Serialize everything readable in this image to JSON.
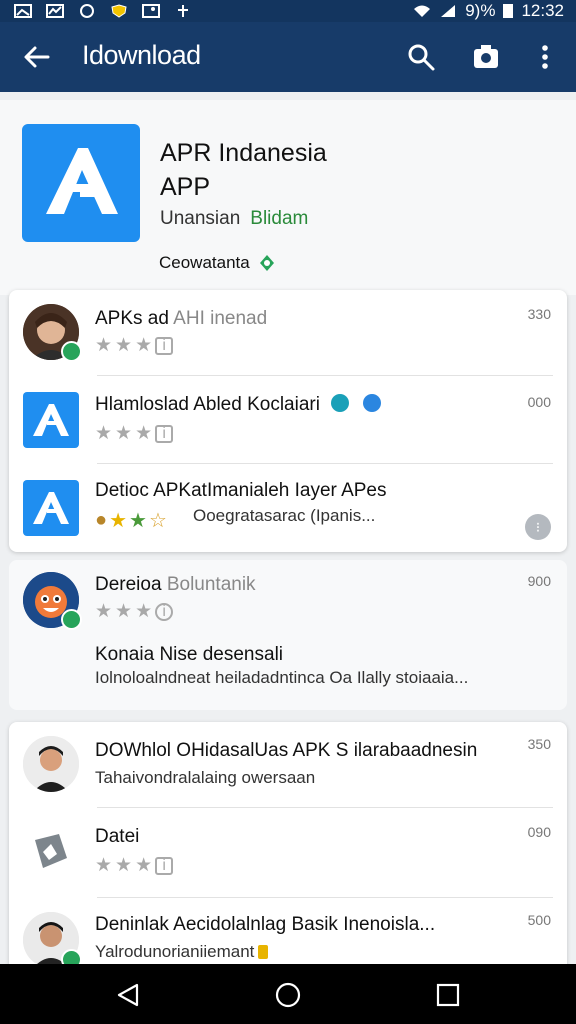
{
  "status_bar": {
    "battery": "9)%",
    "time": "12:32"
  },
  "app_bar": {
    "title": "Idownload"
  },
  "app_header": {
    "title_line1": "APR Indanesia",
    "title_line2": "APP",
    "developer": "Unansian",
    "developer_tag": "Blidam",
    "status": "Ceowatanta"
  },
  "list_card1": [
    {
      "title": "APKs ad ",
      "title_grey": "AHI inenad",
      "size": "330"
    },
    {
      "title": "Hlamloslad Abled Koclaiari",
      "size": "000"
    },
    {
      "title": "Detioc APKatImanialeh Iayer APes",
      "subtitle": "Ooegratasarac (Ipanis..."
    }
  ],
  "list_card2": {
    "title": "Dereioa ",
    "title_grey": "Boluntanik",
    "size": "900",
    "line1": "Konaia Nise desensali",
    "line2": "Iolnoloalndneat heiladadntinca Oa Ilally stoiaaia..."
  },
  "list_card3": [
    {
      "title": "DOWhlol OHidasalUas APK S ilarabaadnesin",
      "subtitle": "Tahaivondralalaing owersaan",
      "size": "350"
    },
    {
      "title": "Datei",
      "size": "090"
    },
    {
      "title": "Deninlak Aecidolalnlag Basik Inenoisla...",
      "subtitle": "Yalrodunorianiiemant",
      "size": "500"
    }
  ],
  "colors": {
    "appbar": "#173b69",
    "statusbar": "#13355f",
    "accent_blue": "#1f8ef0",
    "green": "#27a45a"
  }
}
